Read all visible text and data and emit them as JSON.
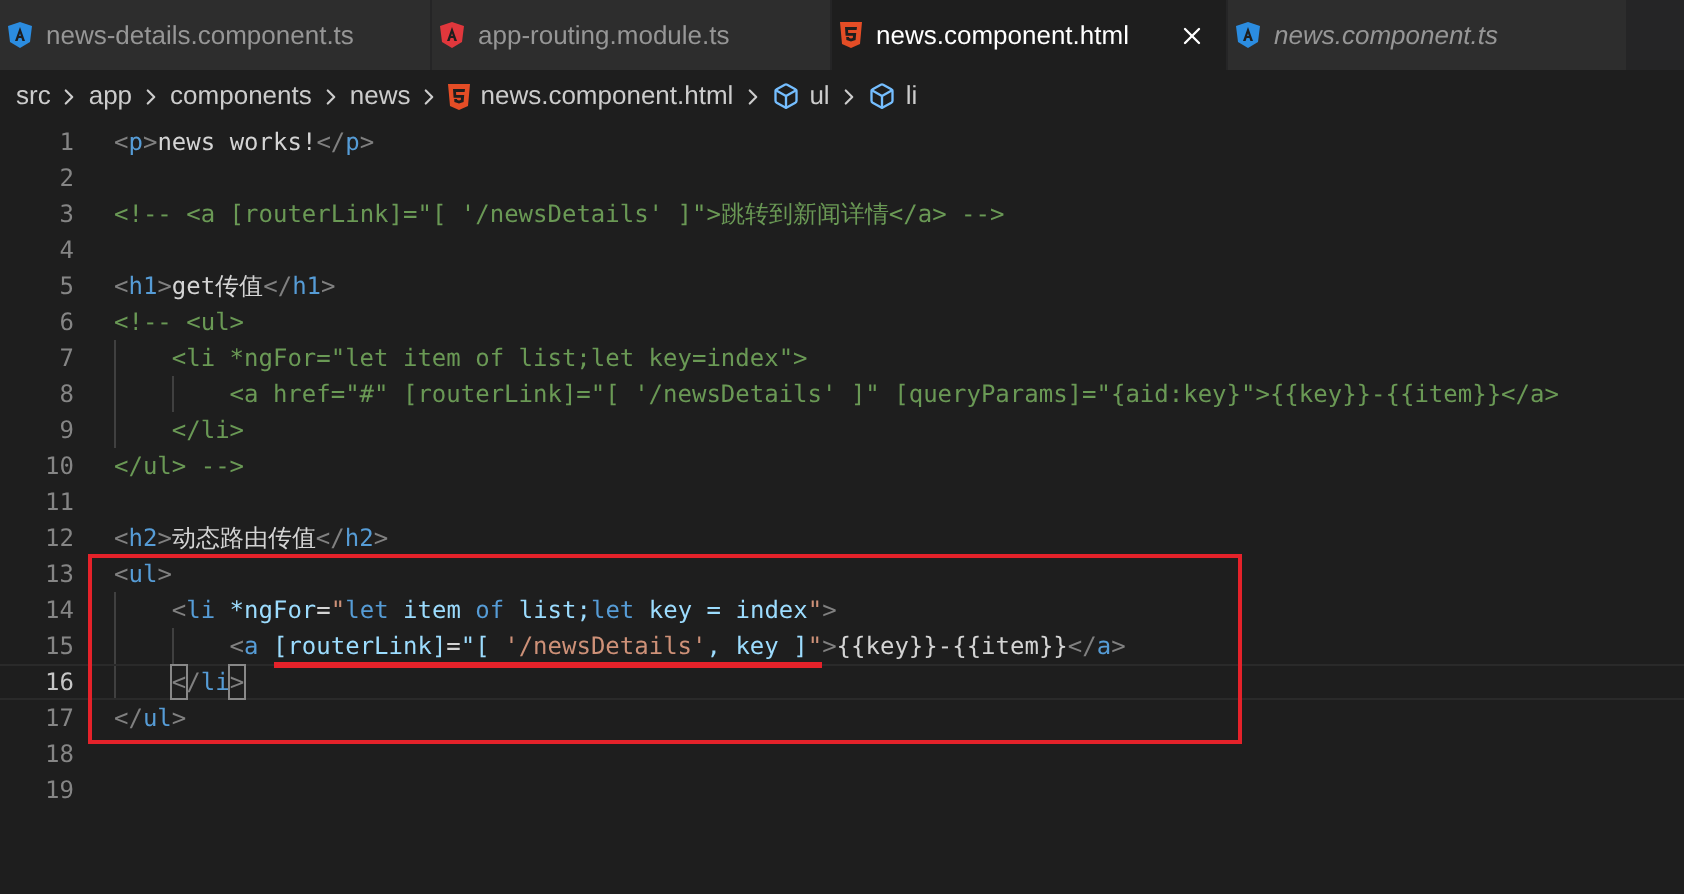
{
  "tabs": [
    {
      "label": "news-details.component.ts",
      "kind": "angular",
      "color": "#2b8ce0",
      "selected": false,
      "preview": false
    },
    {
      "label": "app-routing.module.ts",
      "kind": "angular",
      "color": "#e0373c",
      "selected": false,
      "preview": false
    },
    {
      "label": "news.component.html",
      "kind": "html",
      "color": "#e44d26",
      "selected": true,
      "preview": false
    },
    {
      "label": "news.component.ts",
      "kind": "angular",
      "color": "#2b8ce0",
      "selected": false,
      "preview": true
    }
  ],
  "breadcrumbs": [
    {
      "label": "src",
      "kind": "folder"
    },
    {
      "label": "app",
      "kind": "folder"
    },
    {
      "label": "components",
      "kind": "folder"
    },
    {
      "label": "news",
      "kind": "folder"
    },
    {
      "label": "news.component.html",
      "kind": "html"
    },
    {
      "label": "ul",
      "kind": "symbol"
    },
    {
      "label": "li",
      "kind": "symbol"
    }
  ],
  "editor": {
    "lines": [
      {
        "number": "1",
        "current": false,
        "tokens": [
          {
            "text": "<",
            "kind": "punct"
          },
          {
            "text": "p",
            "kind": "tag"
          },
          {
            "text": ">",
            "kind": "punct"
          },
          {
            "text": "news works!",
            "kind": "text"
          },
          {
            "text": "</",
            "kind": "punct"
          },
          {
            "text": "p",
            "kind": "tag"
          },
          {
            "text": ">",
            "kind": "punct"
          }
        ]
      },
      {
        "number": "2",
        "current": false
      },
      {
        "number": "3",
        "current": false,
        "tokens": [
          {
            "text": "<!-- <a [routerLink]=\"[ '/newsDetails' ]\">跳转到新闻详情</a> -->",
            "kind": "comment"
          }
        ]
      },
      {
        "number": "4",
        "current": false
      },
      {
        "number": "5",
        "current": false,
        "tokens": [
          {
            "text": "<",
            "kind": "punct"
          },
          {
            "text": "h1",
            "kind": "tag"
          },
          {
            "text": ">",
            "kind": "punct"
          },
          {
            "text": "get传值",
            "kind": "text"
          },
          {
            "text": "</",
            "kind": "punct"
          },
          {
            "text": "h1",
            "kind": "tag"
          },
          {
            "text": ">",
            "kind": "punct"
          }
        ]
      },
      {
        "number": "6",
        "current": false,
        "tokens": [
          {
            "text": "<!-- <ul>",
            "kind": "comment"
          }
        ],
        "children": [
          {
            "number": "7",
            "current": false,
            "tokens": [
              {
                "text": "<li *ngFor=\"let item of list;let key=index\">",
                "kind": "comment"
              }
            ],
            "children": [
              {
                "number": "8",
                "current": false,
                "tokens": [
                  {
                    "text": "<a href=\"#\" [routerLink]=\"[ '/newsDetails' ]\" [queryParams]=\"{aid:key}\">{{key}}-{{item}}</a>",
                    "kind": "comment"
                  }
                ]
              }
            ]
          },
          {
            "number": "9",
            "current": false,
            "tokens": [
              {
                "text": "</li>",
                "kind": "comment"
              }
            ]
          }
        ]
      },
      {
        "number": "10",
        "current": false,
        "tokens": [
          {
            "text": "</ul> -->",
            "kind": "comment"
          }
        ]
      },
      {
        "number": "11",
        "current": false
      },
      {
        "number": "12",
        "current": false,
        "tokens": [
          {
            "text": "<",
            "kind": "punct"
          },
          {
            "text": "h2",
            "kind": "tag"
          },
          {
            "text": ">",
            "kind": "punct"
          },
          {
            "text": "动态路由传值",
            "kind": "text"
          },
          {
            "text": "</",
            "kind": "punct"
          },
          {
            "text": "h2",
            "kind": "tag"
          },
          {
            "text": ">",
            "kind": "punct"
          }
        ]
      },
      {
        "number": "13",
        "current": false,
        "tokens": [
          {
            "text": "<",
            "kind": "punct"
          },
          {
            "text": "ul",
            "kind": "tag"
          },
          {
            "text": ">",
            "kind": "punct"
          }
        ],
        "children": [
          {
            "number": "14",
            "current": false,
            "tokens": [
              {
                "text": "<",
                "kind": "punct"
              },
              {
                "text": "li",
                "kind": "tag"
              },
              {
                "text": " *ngFor",
                "kind": "attr"
              },
              {
                "text": "=",
                "kind": "text"
              },
              {
                "text": "\"",
                "kind": "str"
              },
              {
                "text": "let",
                "kind": "kw"
              },
              {
                "text": " item ",
                "kind": "var"
              },
              {
                "text": "of",
                "kind": "kw"
              },
              {
                "text": " list;",
                "kind": "var"
              },
              {
                "text": "let",
                "kind": "kw"
              },
              {
                "text": " key = index",
                "kind": "var"
              },
              {
                "text": "\"",
                "kind": "str"
              },
              {
                "text": ">",
                "kind": "punct"
              }
            ],
            "children": [
              {
                "number": "15",
                "current": false,
                "tokens": [
                  {
                    "text": "<",
                    "kind": "punct"
                  },
                  {
                    "text": "a",
                    "kind": "tag"
                  },
                  {
                    "text": " [routerLink]",
                    "kind": "attr"
                  },
                  {
                    "text": "=",
                    "kind": "text"
                  },
                  {
                    "text": "\"[ ",
                    "kind": "var"
                  },
                  {
                    "text": "'/newsDetails'",
                    "kind": "str"
                  },
                  {
                    "text": ", key ]",
                    "kind": "var"
                  },
                  {
                    "text": "\"",
                    "kind": "str"
                  },
                  {
                    "text": ">",
                    "kind": "punct"
                  },
                  {
                    "text": "{{key}}-{{item}}",
                    "kind": "text"
                  },
                  {
                    "text": "</",
                    "kind": "punct"
                  },
                  {
                    "text": "a",
                    "kind": "tag"
                  },
                  {
                    "text": ">",
                    "kind": "punct"
                  }
                ]
              }
            ]
          },
          {
            "number": "16",
            "current": true,
            "tokens": [
              {
                "text": "<",
                "kind": "match"
              },
              {
                "text": "/",
                "kind": "punct"
              },
              {
                "text": "li",
                "kind": "tag"
              },
              {
                "text": ">",
                "kind": "match"
              }
            ]
          }
        ]
      },
      {
        "number": "17",
        "current": false,
        "tokens": [
          {
            "text": "</",
            "kind": "punct"
          },
          {
            "text": "ul",
            "kind": "tag"
          },
          {
            "text": ">",
            "kind": "punct"
          }
        ]
      },
      {
        "number": "18",
        "current": false
      },
      {
        "number": "19",
        "current": false
      }
    ]
  }
}
